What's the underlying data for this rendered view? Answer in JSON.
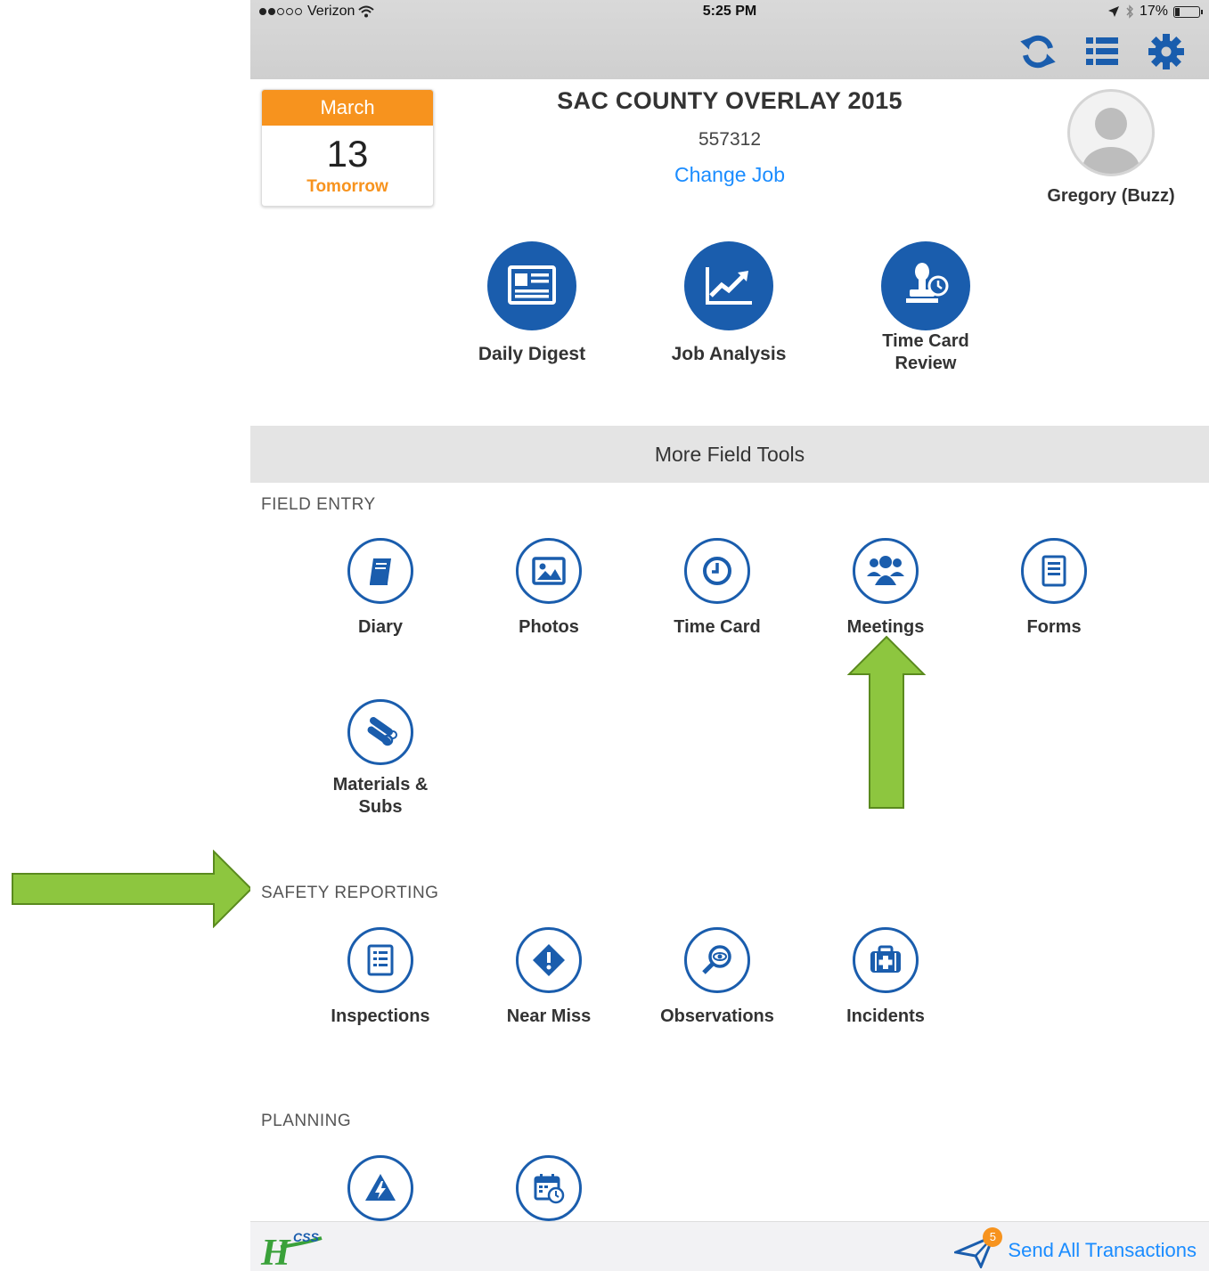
{
  "status_bar": {
    "carrier": "Verizon",
    "time": "5:25 PM",
    "battery": "17%",
    "battery_level": 0.17
  },
  "toolbar": {
    "icons": [
      "sync-icon",
      "list-icon",
      "gear-icon"
    ]
  },
  "date_card": {
    "month": "March",
    "day": "13",
    "relative": "Tomorrow"
  },
  "job": {
    "title": "SAC COUNTY OVERLAY 2015",
    "number": "557312",
    "change_label": "Change Job"
  },
  "user": {
    "name": "Gregory (Buzz)"
  },
  "quick_actions": [
    {
      "label": "Daily Digest",
      "icon": "newspaper-icon"
    },
    {
      "label": "Job Analysis",
      "icon": "line-chart-icon"
    },
    {
      "label": "Time Card Review",
      "icon": "stamp-icon"
    }
  ],
  "more_tools": {
    "title": "More Field Tools"
  },
  "sections": {
    "field_entry": {
      "heading": "FIELD ENTRY",
      "items": [
        {
          "label": "Diary",
          "icon": "book-icon"
        },
        {
          "label": "Photos",
          "icon": "image-icon"
        },
        {
          "label": "Time Card",
          "icon": "clock-icon"
        },
        {
          "label": "Meetings",
          "icon": "group-icon"
        },
        {
          "label": "Forms",
          "icon": "form-icon"
        },
        {
          "label": "Materials & Subs",
          "icon": "materials-icon"
        }
      ]
    },
    "safety_reporting": {
      "heading": "SAFETY REPORTING",
      "items": [
        {
          "label": "Inspections",
          "icon": "checklist-icon"
        },
        {
          "label": "Near Miss",
          "icon": "warning-diamond-icon"
        },
        {
          "label": "Observations",
          "icon": "magnifier-eye-icon"
        },
        {
          "label": "Incidents",
          "icon": "first-aid-icon"
        }
      ]
    },
    "planning": {
      "heading": "PLANNING",
      "items": [
        {
          "label": "",
          "icon": "hazard-triangle-icon"
        },
        {
          "label": "",
          "icon": "calendar-clock-icon"
        }
      ]
    }
  },
  "footer": {
    "logo_text": "HCSS",
    "send_label": "Send All Transactions",
    "badge_count": "5"
  },
  "colors": {
    "primary_blue": "#1a5dad",
    "link_blue": "#1a8cff",
    "accent_orange": "#f7931e",
    "callout_green": "#8dc63f"
  }
}
